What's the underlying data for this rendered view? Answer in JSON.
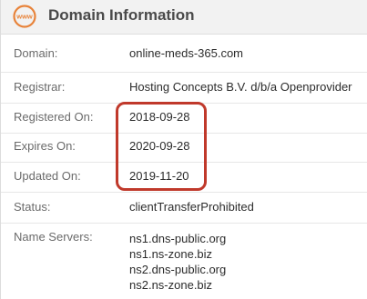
{
  "panel": {
    "title": "Domain Information",
    "logo_text": "www"
  },
  "rows": [
    {
      "label": "Domain:",
      "value": "online-meds-365.com"
    },
    {
      "label": "Registrar:",
      "value": "Hosting Concepts B.V. d/b/a Openprovider"
    },
    {
      "label": "Registered On:",
      "value": "2018-09-28"
    },
    {
      "label": "Expires On:",
      "value": "2020-09-28"
    },
    {
      "label": "Updated On:",
      "value": "2019-11-20"
    },
    {
      "label": "Status:",
      "value": "clientTransferProhibited"
    }
  ],
  "name_servers": {
    "label": "Name Servers:",
    "values": [
      "ns1.dns-public.org",
      "ns1.ns-zone.biz",
      "ns2.dns-public.org",
      "ns2.ns-zone.biz"
    ]
  },
  "colors": {
    "logo": "#e8833a",
    "highlight": "#c0392b",
    "header_bg": "#f2f2f2"
  }
}
